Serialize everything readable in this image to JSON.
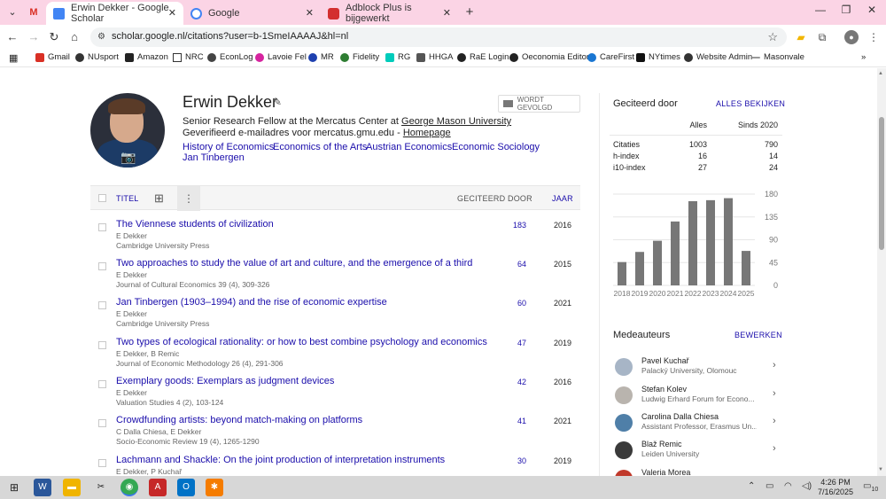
{
  "browser": {
    "tabs": [
      {
        "label": "Erwin Dekker - Google Scholar",
        "active": true
      },
      {
        "label": "Google",
        "active": false
      },
      {
        "label": "Adblock Plus is bijgewerkt",
        "active": false
      }
    ],
    "url": "scholar.google.nl/citations?user=b-1SmeIAAAAJ&hl=nl",
    "bookmarks": [
      "Gmail",
      "NUsport",
      "Amazon",
      "NRC",
      "EconLog",
      "Lavoie Fel",
      "MR",
      "Fidelity",
      "RG",
      "HHGA",
      "RaE Login",
      "Oeconomia Editor",
      "CareFirst",
      "NYtimes",
      "Website Admin",
      "Masonvale"
    ]
  },
  "profile": {
    "name": "Erwin Dekker",
    "affiliation_prefix": "Senior Research Fellow at the Mercatus Center at",
    "affiliation_link": "George Mason University",
    "email_prefix": "Geverifieerd e-mailadres voor mercatus.gmu.edu -",
    "homepage": "Homepage",
    "interests": [
      "History of Economics",
      "Economics of the Arts",
      "Austrian Economics",
      "Economic Sociology",
      "Jan Tinbergen"
    ],
    "follow_label": "WORDT GEVOLGD"
  },
  "articles_header": {
    "title": "TITEL",
    "cited_by": "GECITEERD DOOR",
    "year": "JAAR"
  },
  "articles": [
    {
      "title": "The Viennese students of civilization",
      "authors": "E Dekker",
      "venue": "Cambridge University Press",
      "cited": "183",
      "year": "2016"
    },
    {
      "title": "Two approaches to study the value of art and culture, and the emergence of a third",
      "authors": "E Dekker",
      "venue": "Journal of Cultural Economics 39 (4), 309-326",
      "cited": "64",
      "year": "2015"
    },
    {
      "title": "Jan Tinbergen (1903–1994) and the rise of economic expertise",
      "authors": "E Dekker",
      "venue": "Cambridge University Press",
      "cited": "60",
      "year": "2021"
    },
    {
      "title": "Two types of ecological rationality: or how to best combine psychology and economics",
      "authors": "E Dekker, B Remic",
      "venue": "Journal of Economic Methodology 26 (4), 291-306",
      "cited": "47",
      "year": "2019"
    },
    {
      "title": "Exemplary goods: Exemplars as judgment devices",
      "authors": "E Dekker",
      "venue": "Valuation Studies 4 (2), 103-124",
      "cited": "42",
      "year": "2016"
    },
    {
      "title": "Crowdfunding artists: beyond match-making on platforms",
      "authors": "C Dalla Chiesa, E Dekker",
      "venue": "Socio-Economic Review 19 (4), 1265-1290",
      "cited": "41",
      "year": "2021"
    },
    {
      "title": "Lachmann and Shackle: On the joint production of interpretation instruments",
      "authors": "E Dekker, P Kuchař",
      "venue": "",
      "cited": "30",
      "year": "2019"
    }
  ],
  "cited_by": {
    "title": "Geciteerd door",
    "view_all": "ALLES BEKIJKEN",
    "col_all": "Alles",
    "col_since": "Sinds 2020",
    "rows": [
      {
        "label": "Citaties",
        "all": "1003",
        "since": "790"
      },
      {
        "label": "h-index",
        "all": "16",
        "since": "14"
      },
      {
        "label": "i10-index",
        "all": "27",
        "since": "24"
      }
    ]
  },
  "chart_data": {
    "type": "bar",
    "categories": [
      "2018",
      "2019",
      "2020",
      "2021",
      "2022",
      "2023",
      "2024",
      "2025"
    ],
    "values": [
      46,
      66,
      88,
      126,
      166,
      168,
      172,
      68
    ],
    "ylim": [
      0,
      180
    ],
    "yticks": [
      "0",
      "45",
      "90",
      "135",
      "180"
    ],
    "bar_color": "#777777"
  },
  "coauthors": {
    "title": "Medeauteurs",
    "edit": "BEWERKEN",
    "items": [
      {
        "name": "Pavel Kuchař",
        "affiliation": "Palacký University, Olomouc"
      },
      {
        "name": "Stefan Kolev",
        "affiliation": "Ludwig Erhard Forum for Econo..."
      },
      {
        "name": "Carolina Dalla Chiesa",
        "affiliation": "Assistant Professor, Erasmus Un..."
      },
      {
        "name": "Blaž Remic",
        "affiliation": "Leiden University"
      },
      {
        "name": "Valeria Morea",
        "affiliation": ""
      }
    ]
  },
  "taskbar": {
    "time": "4:26 PM",
    "date": "7/16/2025",
    "notifications": "10"
  }
}
